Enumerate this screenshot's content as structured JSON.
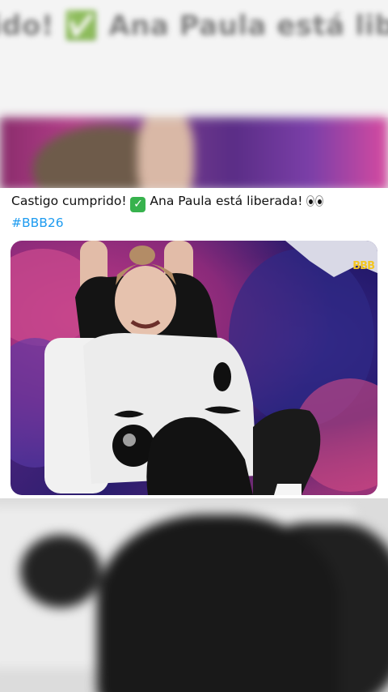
{
  "background": {
    "top_blurred_text": "ido! ✅ Ana Paula está liber"
  },
  "post": {
    "caption_text": "Castigo cumprido!",
    "caption_text_2": "Ana Paula está liberada!",
    "check_emoji": "✅",
    "hashtag": "#BBB26",
    "media": {
      "watermark": "BBB"
    }
  },
  "colors": {
    "hashtag": "#1d9bf0",
    "check_emoji_bg": "#37b24d",
    "card_bg": "#ffffff"
  },
  "icons": [
    "check-emoji-icon",
    "eyes-emoji-icon",
    "bbb-logo-icon"
  ]
}
